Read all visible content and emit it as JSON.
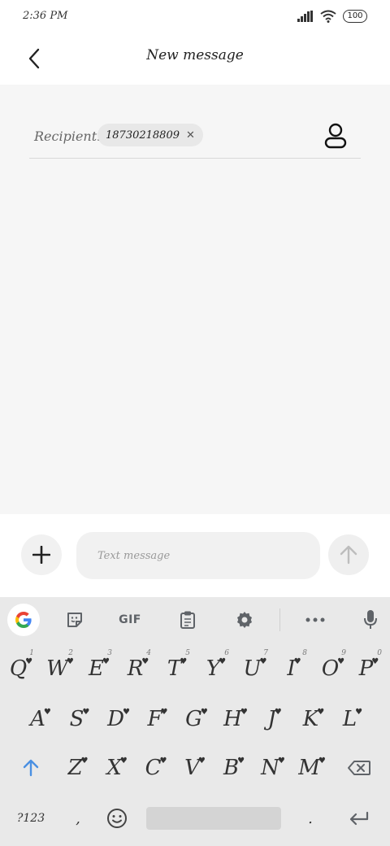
{
  "status_bar": {
    "time": "2:36 PM",
    "battery": "100"
  },
  "header": {
    "title": "New message",
    "back_icon": "chevron-left-icon"
  },
  "recipient": {
    "label": "Recipient:",
    "chip": {
      "value": "18730218809",
      "remove_icon": "close-icon",
      "remove_glyph": "✕"
    },
    "contact_icon": "person-icon"
  },
  "composer": {
    "add_icon": "plus-icon",
    "placeholder": "Text message",
    "value": "",
    "send_icon": "arrow-up-icon"
  },
  "keyboard": {
    "toolbar": {
      "items": [
        "google-icon",
        "sticker-icon",
        "gif",
        "clipboard-icon",
        "gear-icon",
        "more-icon",
        "mic-icon"
      ],
      "gif_label": "GIF"
    },
    "rows": [
      {
        "keys": [
          "Q",
          "W",
          "E",
          "R",
          "T",
          "Y",
          "U",
          "I",
          "O",
          "P"
        ],
        "hints": [
          "1",
          "2",
          "3",
          "4",
          "5",
          "6",
          "7",
          "8",
          "9",
          "0"
        ]
      },
      {
        "keys": [
          "A",
          "S",
          "D",
          "F",
          "G",
          "H",
          "J",
          "K",
          "L"
        ]
      },
      {
        "keys": [
          "Z",
          "X",
          "C",
          "V",
          "B",
          "N",
          "M"
        ]
      }
    ],
    "shift_icon": "shift-arrow-icon",
    "backspace_icon": "backspace-icon",
    "symbols_label": "?123",
    "comma": ",",
    "period": ".",
    "emoji_icon": "emoji-icon",
    "enter_icon": "enter-icon",
    "colors": {
      "shift_blue": "#4a90e2",
      "google_red": "#ea4335",
      "google_blue": "#4285f4",
      "google_yellow": "#fbbc05",
      "google_green": "#34a853"
    }
  }
}
